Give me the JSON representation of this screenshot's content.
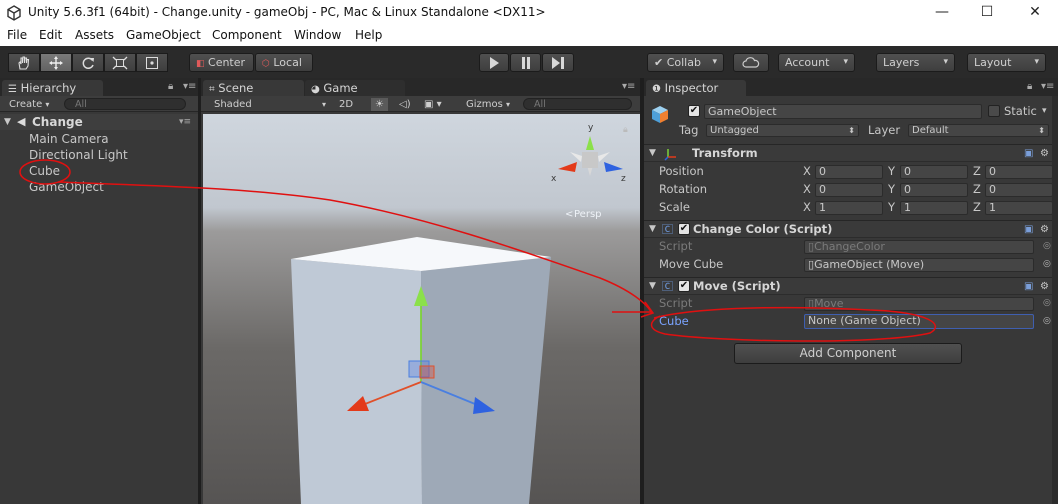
{
  "window": {
    "title": "Unity 5.6.3f1 (64bit) - Change.unity - gameObj - PC, Mac & Linux Standalone <DX11>",
    "minimize": "—",
    "maximize": "☐",
    "close": "✕"
  },
  "menu": [
    "File",
    "Edit",
    "Assets",
    "GameObject",
    "Component",
    "Window",
    "Help"
  ],
  "toolbar": {
    "pivot": "Center",
    "space": "Local",
    "collab": "Collab",
    "account": "Account",
    "layers": "Layers",
    "layout": "Layout"
  },
  "hierarchy": {
    "tab": "Hierarchy",
    "create": "Create",
    "search_placeholder": "All",
    "scene": "Change",
    "items": [
      "Main Camera",
      "Directional Light",
      "Cube",
      "GameObject"
    ]
  },
  "scene": {
    "tab_scene": "Scene",
    "tab_game": "Game",
    "shading": "Shaded",
    "mode2d": "2D",
    "gizmos": "Gizmos",
    "search_placeholder": "All",
    "persp": "Persp",
    "axis_x": "x",
    "axis_y": "y",
    "axis_z": "z"
  },
  "inspector": {
    "tab": "Inspector",
    "name": "GameObject",
    "static": "Static",
    "tag_label": "Tag",
    "tag": "Untagged",
    "layer_label": "Layer",
    "layer": "Default",
    "transform": {
      "title": "Transform",
      "rows": [
        {
          "label": "Position",
          "x": "0",
          "y": "0",
          "z": "0"
        },
        {
          "label": "Rotation",
          "x": "0",
          "y": "0",
          "z": "0"
        },
        {
          "label": "Scale",
          "x": "1",
          "y": "1",
          "z": "1"
        }
      ],
      "xl": "X",
      "yl": "Y",
      "zl": "Z"
    },
    "change_color": {
      "title": "Change Color (Script)",
      "script_label": "Script",
      "script_value": "ChangeColor",
      "field_label": "Move Cube",
      "field_value": "GameObject (Move)"
    },
    "move": {
      "title": "Move (Script)",
      "script_label": "Script",
      "script_value": "Move",
      "field_label": "Cube",
      "field_value": "None (Game Object)"
    },
    "add_component": "Add Component"
  },
  "colors": {
    "annotation": "#e01010",
    "accent_blue": "#7aa3ff"
  }
}
